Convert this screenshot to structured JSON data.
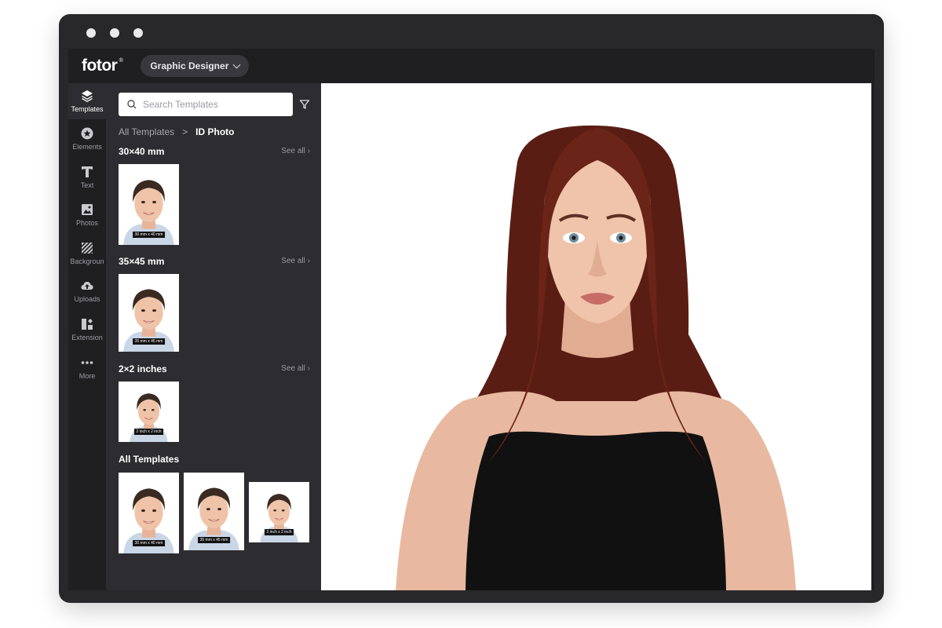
{
  "app": {
    "logo": "fotor",
    "logo_mark": "®",
    "role_label": "Graphic Designer"
  },
  "rail": {
    "items": [
      {
        "label": "Templates",
        "icon": "layers-icon",
        "active": true
      },
      {
        "label": "Elements",
        "icon": "star-badge-icon"
      },
      {
        "label": "Text",
        "icon": "text-t-icon"
      },
      {
        "label": "Photos",
        "icon": "image-icon"
      },
      {
        "label": "Backgroun",
        "icon": "stripes-icon"
      },
      {
        "label": "Uploads",
        "icon": "cloud-upload-icon"
      },
      {
        "label": "Extension",
        "icon": "apps-icon"
      },
      {
        "label": "More",
        "icon": "ellipsis-icon"
      }
    ]
  },
  "panel": {
    "search_placeholder": "Search Templates",
    "breadcrumb_root": "All Templates",
    "breadcrumb_sep": ">",
    "breadcrumb_current": "ID Photo",
    "see_all": "See all",
    "sections": [
      {
        "title": "30×40 mm",
        "captions": [
          "30 mm x 40 mm"
        ]
      },
      {
        "title": "35×45 mm",
        "captions": [
          "35 mm x 45 mm"
        ]
      },
      {
        "title": "2×2 inches",
        "captions": [
          "2 inch x 2 inch"
        ]
      },
      {
        "title": "All Templates",
        "captions": [
          "30 mm x 40 mm",
          "35 mm x 45 mm",
          "2 inch x 2 inch"
        ]
      }
    ]
  },
  "colors": {
    "window_frame": "#28282b",
    "app_bg": "#1f1f22",
    "panel_bg": "#2d2d31",
    "hair": "#5a1d14",
    "top": "#111111"
  }
}
